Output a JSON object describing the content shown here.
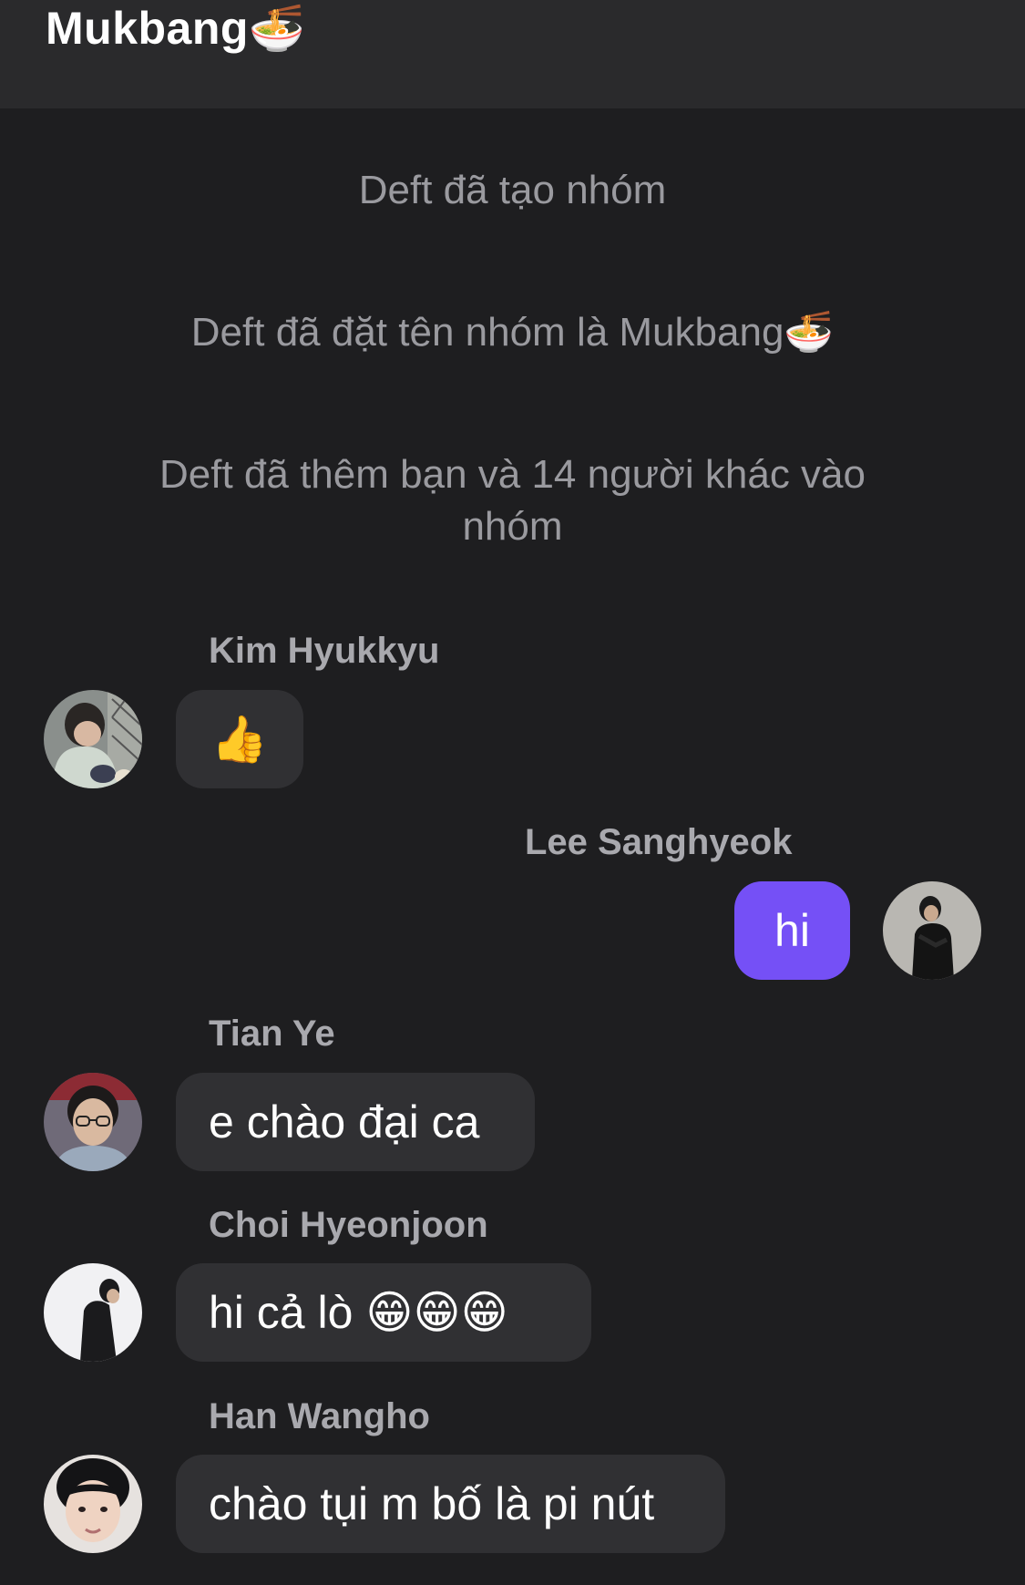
{
  "header": {
    "title": "Mukbang🍜"
  },
  "system_messages": [
    "Deft đã tạo nhóm",
    "Deft đã đặt tên nhóm là Mukbang🍜",
    "Deft đã thêm bạn và 14 người khác vào nhóm"
  ],
  "messages": [
    {
      "sender": "Kim Hyukkyu",
      "text": "👍",
      "mine": false
    },
    {
      "sender": "Lee Sanghyeok",
      "text": "hi",
      "mine": true
    },
    {
      "sender": "Tian Ye",
      "text": "e chào đại ca",
      "mine": false
    },
    {
      "sender": "Choi Hyeonjoon",
      "text": "hi cả lò 😁😁😁",
      "mine": false
    },
    {
      "sender": "Han Wangho",
      "text": "chào tụi m bố là pi nút",
      "mine": false
    }
  ],
  "colors": {
    "background": "#1e1e20",
    "header": "#2a2a2c",
    "bubble_other": "#303033",
    "bubble_mine": "#7550f6",
    "system_text": "#9a9a9f"
  }
}
